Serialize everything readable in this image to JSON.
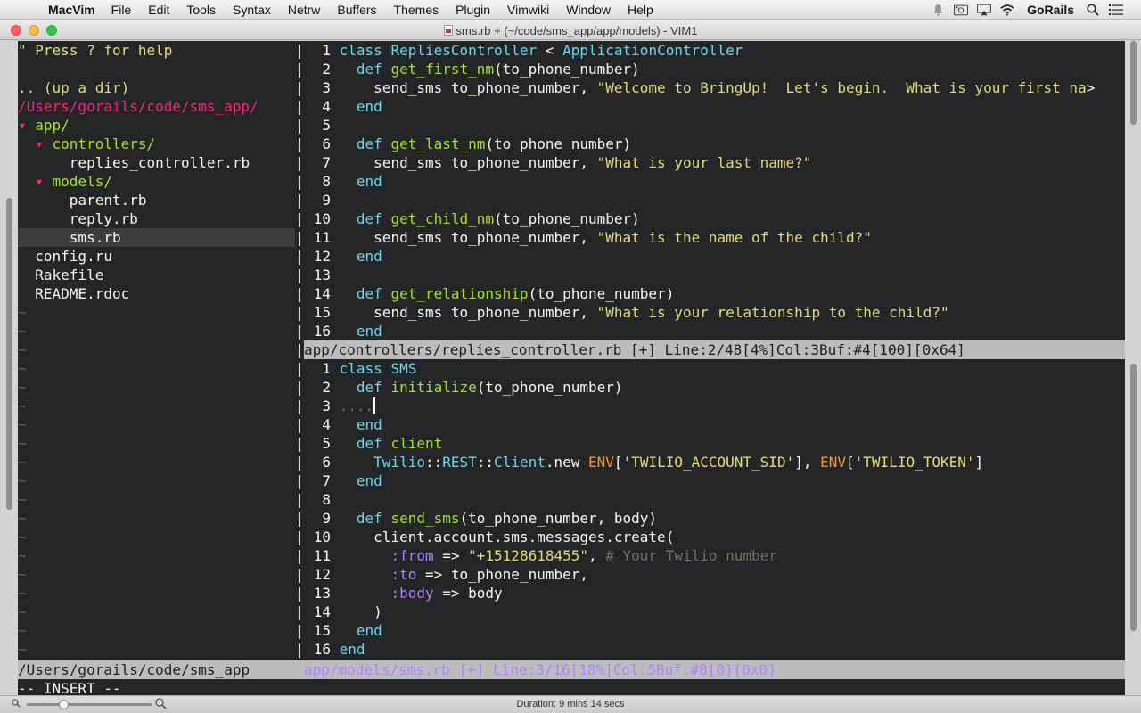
{
  "menubar": {
    "apple_glyph": "",
    "app_name": "MacVim",
    "items": [
      "File",
      "Edit",
      "Tools",
      "Syntax",
      "Netrw",
      "Buffers",
      "Themes",
      "Plugin",
      "Vimwiki",
      "Window",
      "Help"
    ],
    "user": "GoRails",
    "icons": [
      "notification-icon",
      "camera-icon",
      "airplay-icon",
      "wifi-icon",
      "search-icon",
      "list-icon"
    ]
  },
  "window": {
    "title": "sms.rb + (~/code/sms_app/app/models) - VIM1",
    "traffic_colors": {
      "close": "#fc605c",
      "minimize": "#fdbc40",
      "zoom": "#34c749"
    }
  },
  "tree": {
    "lines": [
      {
        "text": "\" Press ? for help",
        "kind": "help"
      },
      {
        "text": "",
        "kind": "blank"
      },
      {
        "text": ".. (up a dir)",
        "kind": "updir"
      },
      {
        "text": "/Users/gorails/code/sms_app/",
        "kind": "root"
      },
      {
        "indent": "",
        "arrow": "▾ ",
        "text": "app/",
        "kind": "dir"
      },
      {
        "indent": "  ",
        "arrow": "▾ ",
        "text": "controllers/",
        "kind": "dir"
      },
      {
        "indent": "      ",
        "text": "replies_controller.rb",
        "kind": "file"
      },
      {
        "indent": "  ",
        "arrow": "▾ ",
        "text": "models/",
        "kind": "dir"
      },
      {
        "indent": "      ",
        "text": "parent.rb",
        "kind": "file"
      },
      {
        "indent": "      ",
        "text": "reply.rb",
        "kind": "file"
      },
      {
        "indent": "      ",
        "text": "sms.rb",
        "kind": "file",
        "selected": true
      },
      {
        "indent": "  ",
        "text": "config.ru",
        "kind": "file"
      },
      {
        "indent": "  ",
        "text": "Rakefile",
        "kind": "file"
      },
      {
        "indent": "  ",
        "text": "README.rdoc",
        "kind": "file"
      }
    ],
    "tilde": "~",
    "status": "/Users/gorails/code/sms_app"
  },
  "top_pane": {
    "lines": [
      {
        "n": "1",
        "t": [
          [
            "k",
            "class "
          ],
          [
            "cls",
            "RepliesController"
          ],
          [
            "tx",
            " < "
          ],
          [
            "cls",
            "ApplicationController"
          ]
        ]
      },
      {
        "n": "2",
        "t": [
          [
            "tx",
            "  "
          ],
          [
            "k",
            "def "
          ],
          [
            "fn",
            "get_first_nm"
          ],
          [
            "tx",
            "(to_phone_number)"
          ]
        ]
      },
      {
        "n": "3",
        "t": [
          [
            "tx",
            "    send_sms to_phone_number, "
          ],
          [
            "str",
            "\"Welcome to BringUp!  Let's begin.  What is your first na"
          ],
          [
            "tx",
            ">"
          ]
        ]
      },
      {
        "n": "4",
        "t": [
          [
            "tx",
            "  "
          ],
          [
            "k",
            "end"
          ]
        ]
      },
      {
        "n": "5",
        "t": []
      },
      {
        "n": "6",
        "t": [
          [
            "tx",
            "  "
          ],
          [
            "k",
            "def "
          ],
          [
            "fn",
            "get_last_nm"
          ],
          [
            "tx",
            "(to_phone_number)"
          ]
        ]
      },
      {
        "n": "7",
        "t": [
          [
            "tx",
            "    send_sms to_phone_number, "
          ],
          [
            "str",
            "\"What is your last name?\""
          ]
        ]
      },
      {
        "n": "8",
        "t": [
          [
            "tx",
            "  "
          ],
          [
            "k",
            "end"
          ]
        ]
      },
      {
        "n": "9",
        "t": []
      },
      {
        "n": "10",
        "t": [
          [
            "tx",
            "  "
          ],
          [
            "k",
            "def "
          ],
          [
            "fn",
            "get_child_nm"
          ],
          [
            "tx",
            "(to_phone_number)"
          ]
        ]
      },
      {
        "n": "11",
        "t": [
          [
            "tx",
            "    send_sms to_phone_number, "
          ],
          [
            "str",
            "\"What is the name of the child?\""
          ]
        ]
      },
      {
        "n": "12",
        "t": [
          [
            "tx",
            "  "
          ],
          [
            "k",
            "end"
          ]
        ]
      },
      {
        "n": "13",
        "t": []
      },
      {
        "n": "14",
        "t": [
          [
            "tx",
            "  "
          ],
          [
            "k",
            "def "
          ],
          [
            "fn",
            "get_relationship"
          ],
          [
            "tx",
            "(to_phone_number)"
          ]
        ]
      },
      {
        "n": "15",
        "t": [
          [
            "tx",
            "    send_sms to_phone_number, "
          ],
          [
            "str",
            "\"What is your relationship to the child?\""
          ]
        ]
      },
      {
        "n": "16",
        "t": [
          [
            "tx",
            "  "
          ],
          [
            "k",
            "end"
          ]
        ]
      }
    ],
    "status": "app/controllers/replies_controller.rb [+] Line:2/48[4%]Col:3Buf:#4[100][0x64]"
  },
  "bottom_pane": {
    "lines": [
      {
        "n": "1",
        "t": [
          [
            "k",
            "class "
          ],
          [
            "cls",
            "SMS"
          ]
        ]
      },
      {
        "n": "2",
        "t": [
          [
            "tx",
            "  "
          ],
          [
            "k",
            "def "
          ],
          [
            "fn",
            "initialize"
          ],
          [
            "tx",
            "(to_phone_number)"
          ]
        ]
      },
      {
        "n": "3",
        "t": [
          [
            "ws",
            "...."
          ]
        ],
        "cursor": true
      },
      {
        "n": "4",
        "t": [
          [
            "tx",
            "  "
          ],
          [
            "k",
            "end"
          ]
        ]
      },
      {
        "n": "5",
        "t": [
          [
            "tx",
            "  "
          ],
          [
            "k",
            "def "
          ],
          [
            "fn",
            "client"
          ]
        ]
      },
      {
        "n": "6",
        "t": [
          [
            "tx",
            "    "
          ],
          [
            "cls",
            "Twilio"
          ],
          [
            "tx",
            "::"
          ],
          [
            "cls",
            "REST"
          ],
          [
            "tx",
            "::"
          ],
          [
            "cls",
            "Client"
          ],
          [
            "tx",
            ".new "
          ],
          [
            "cnst",
            "ENV"
          ],
          [
            "tx",
            "["
          ],
          [
            "str",
            "'TWILIO_ACCOUNT_SID'"
          ],
          [
            "tx",
            "], "
          ],
          [
            "cnst",
            "ENV"
          ],
          [
            "tx",
            "["
          ],
          [
            "str",
            "'TWILIO_TOKEN'"
          ],
          [
            "tx",
            "]"
          ]
        ]
      },
      {
        "n": "7",
        "t": [
          [
            "tx",
            "  "
          ],
          [
            "k",
            "end"
          ]
        ]
      },
      {
        "n": "8",
        "t": []
      },
      {
        "n": "9",
        "t": [
          [
            "tx",
            "  "
          ],
          [
            "k",
            "def "
          ],
          [
            "fn",
            "send_sms"
          ],
          [
            "tx",
            "(to_phone_number, body)"
          ]
        ]
      },
      {
        "n": "10",
        "t": [
          [
            "tx",
            "    client.account.sms.messages.create("
          ]
        ]
      },
      {
        "n": "11",
        "t": [
          [
            "tx",
            "      "
          ],
          [
            "sym",
            ":from"
          ],
          [
            "tx",
            " => "
          ],
          [
            "str",
            "\"+15128618455\""
          ],
          [
            "tx",
            ", "
          ],
          [
            "cm",
            "# Your Twilio number"
          ]
        ]
      },
      {
        "n": "12",
        "t": [
          [
            "tx",
            "      "
          ],
          [
            "sym",
            ":to"
          ],
          [
            "tx",
            " => to_phone_number,"
          ]
        ]
      },
      {
        "n": "13",
        "t": [
          [
            "tx",
            "      "
          ],
          [
            "sym",
            ":body"
          ],
          [
            "tx",
            " => body"
          ]
        ]
      },
      {
        "n": "14",
        "t": [
          [
            "tx",
            "    )"
          ]
        ]
      },
      {
        "n": "15",
        "t": [
          [
            "tx",
            "  "
          ],
          [
            "k",
            "end"
          ]
        ]
      },
      {
        "n": "16",
        "t": [
          [
            "k",
            "end"
          ]
        ]
      }
    ],
    "status": "app/models/sms.rb [+] Line:3/16[18%]Col:5Buf:#8[0][0x0]"
  },
  "mode_line": "-- INSERT --",
  "bottom_bar": {
    "duration": "Duration: 9 mins 14 secs",
    "zoom_level": 0.3
  }
}
